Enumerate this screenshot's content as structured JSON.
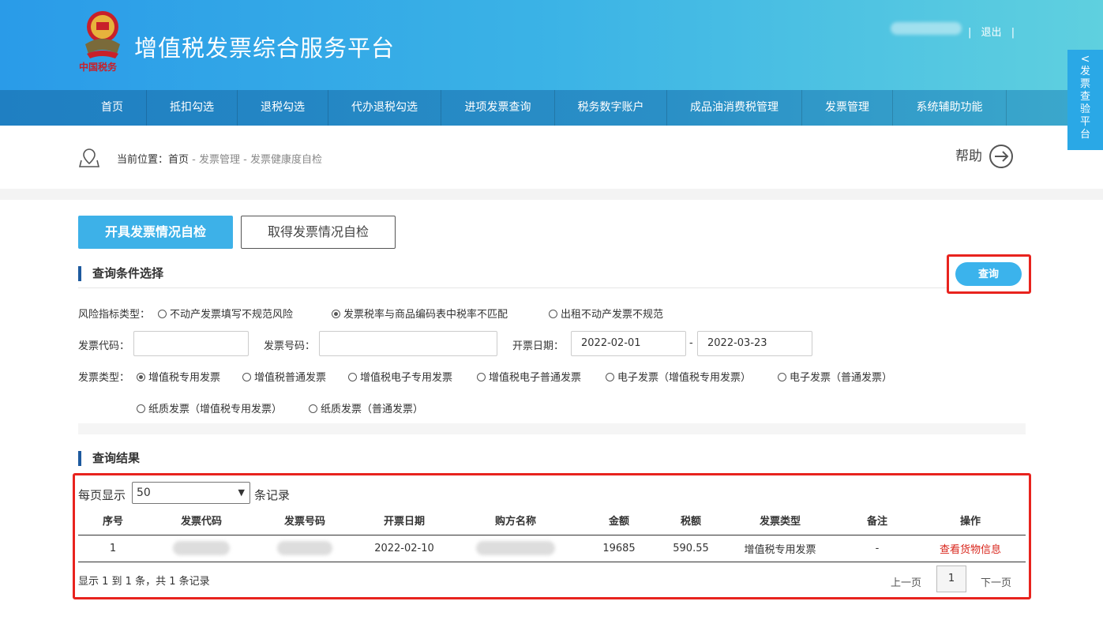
{
  "header": {
    "title": "增值税发票综合服务平台",
    "emblem_caption": "中国税务",
    "logout": "退出",
    "separator": "|"
  },
  "nav": {
    "items": [
      {
        "label": "首页"
      },
      {
        "label": "抵扣勾选"
      },
      {
        "label": "退税勾选"
      },
      {
        "label": "代办退税勾选"
      },
      {
        "label": "进项发票查询"
      },
      {
        "label": "税务数字账户"
      },
      {
        "label": "成品油消费税管理"
      },
      {
        "label": "发票管理"
      },
      {
        "label": "系统辅助功能"
      }
    ]
  },
  "side_tab": {
    "chevron": "<",
    "label": [
      "发",
      "票",
      "查",
      "验",
      "平",
      "台"
    ]
  },
  "breadcrumb": {
    "prefix": "当前位置：",
    "home": "首页",
    "sep": " - ",
    "level1": "发票管理",
    "level2": "发票健康度自检",
    "help": "帮助"
  },
  "tabs": {
    "active": "开具发票情况自检",
    "inactive": "取得发票情况自检"
  },
  "query_section": {
    "title": "查询条件选择",
    "query_button": "查询",
    "risk_label": "风险指标类型：",
    "risk_options": [
      {
        "label": "不动产发票填写不规范风险",
        "selected": false
      },
      {
        "label": "发票税率与商品编码表中税率不匹配",
        "selected": true
      },
      {
        "label": "出租不动产发票不规范",
        "selected": false
      }
    ],
    "invoice_code_label": "发票代码：",
    "invoice_code_value": "",
    "invoice_no_label": "发票号码：",
    "invoice_no_value": "",
    "date_label": "开票日期：",
    "date_from": "2022-02-01",
    "date_sep": "-",
    "date_to": "2022-03-23",
    "type_label": "发票类型：",
    "type_options": [
      {
        "label": "增值税专用发票",
        "selected": true
      },
      {
        "label": "增值税普通发票",
        "selected": false
      },
      {
        "label": "增值税电子专用发票",
        "selected": false
      },
      {
        "label": "增值税电子普通发票",
        "selected": false
      },
      {
        "label": "电子发票（增值税专用发票）",
        "selected": false
      },
      {
        "label": "电子发票（普通发票）",
        "selected": false
      },
      {
        "label": "纸质发票（增值税专用发票）",
        "selected": false
      },
      {
        "label": "纸质发票（普通发票）",
        "selected": false
      }
    ]
  },
  "results": {
    "title": "查询结果",
    "per_page_prefix": "每页显示",
    "per_page_value": "50",
    "per_page_suffix": "条记录",
    "columns": [
      "序号",
      "发票代码",
      "发票号码",
      "开票日期",
      "购方名称",
      "金额",
      "税额",
      "发票类型",
      "备注",
      "操作"
    ],
    "rows": [
      {
        "index": "1",
        "date": "2022-02-10",
        "amount": "19685",
        "tax": "590.55",
        "type": "增值税专用发票",
        "remark": "-",
        "action": "查看货物信息"
      }
    ],
    "summary": "显示 1 到 1 条，共 1 条记录",
    "prev": "上一页",
    "page": "1",
    "next": "下一页"
  },
  "colors": {
    "accent": "#3db1e8",
    "highlight": "#e8231e",
    "link": "#d9261c"
  }
}
